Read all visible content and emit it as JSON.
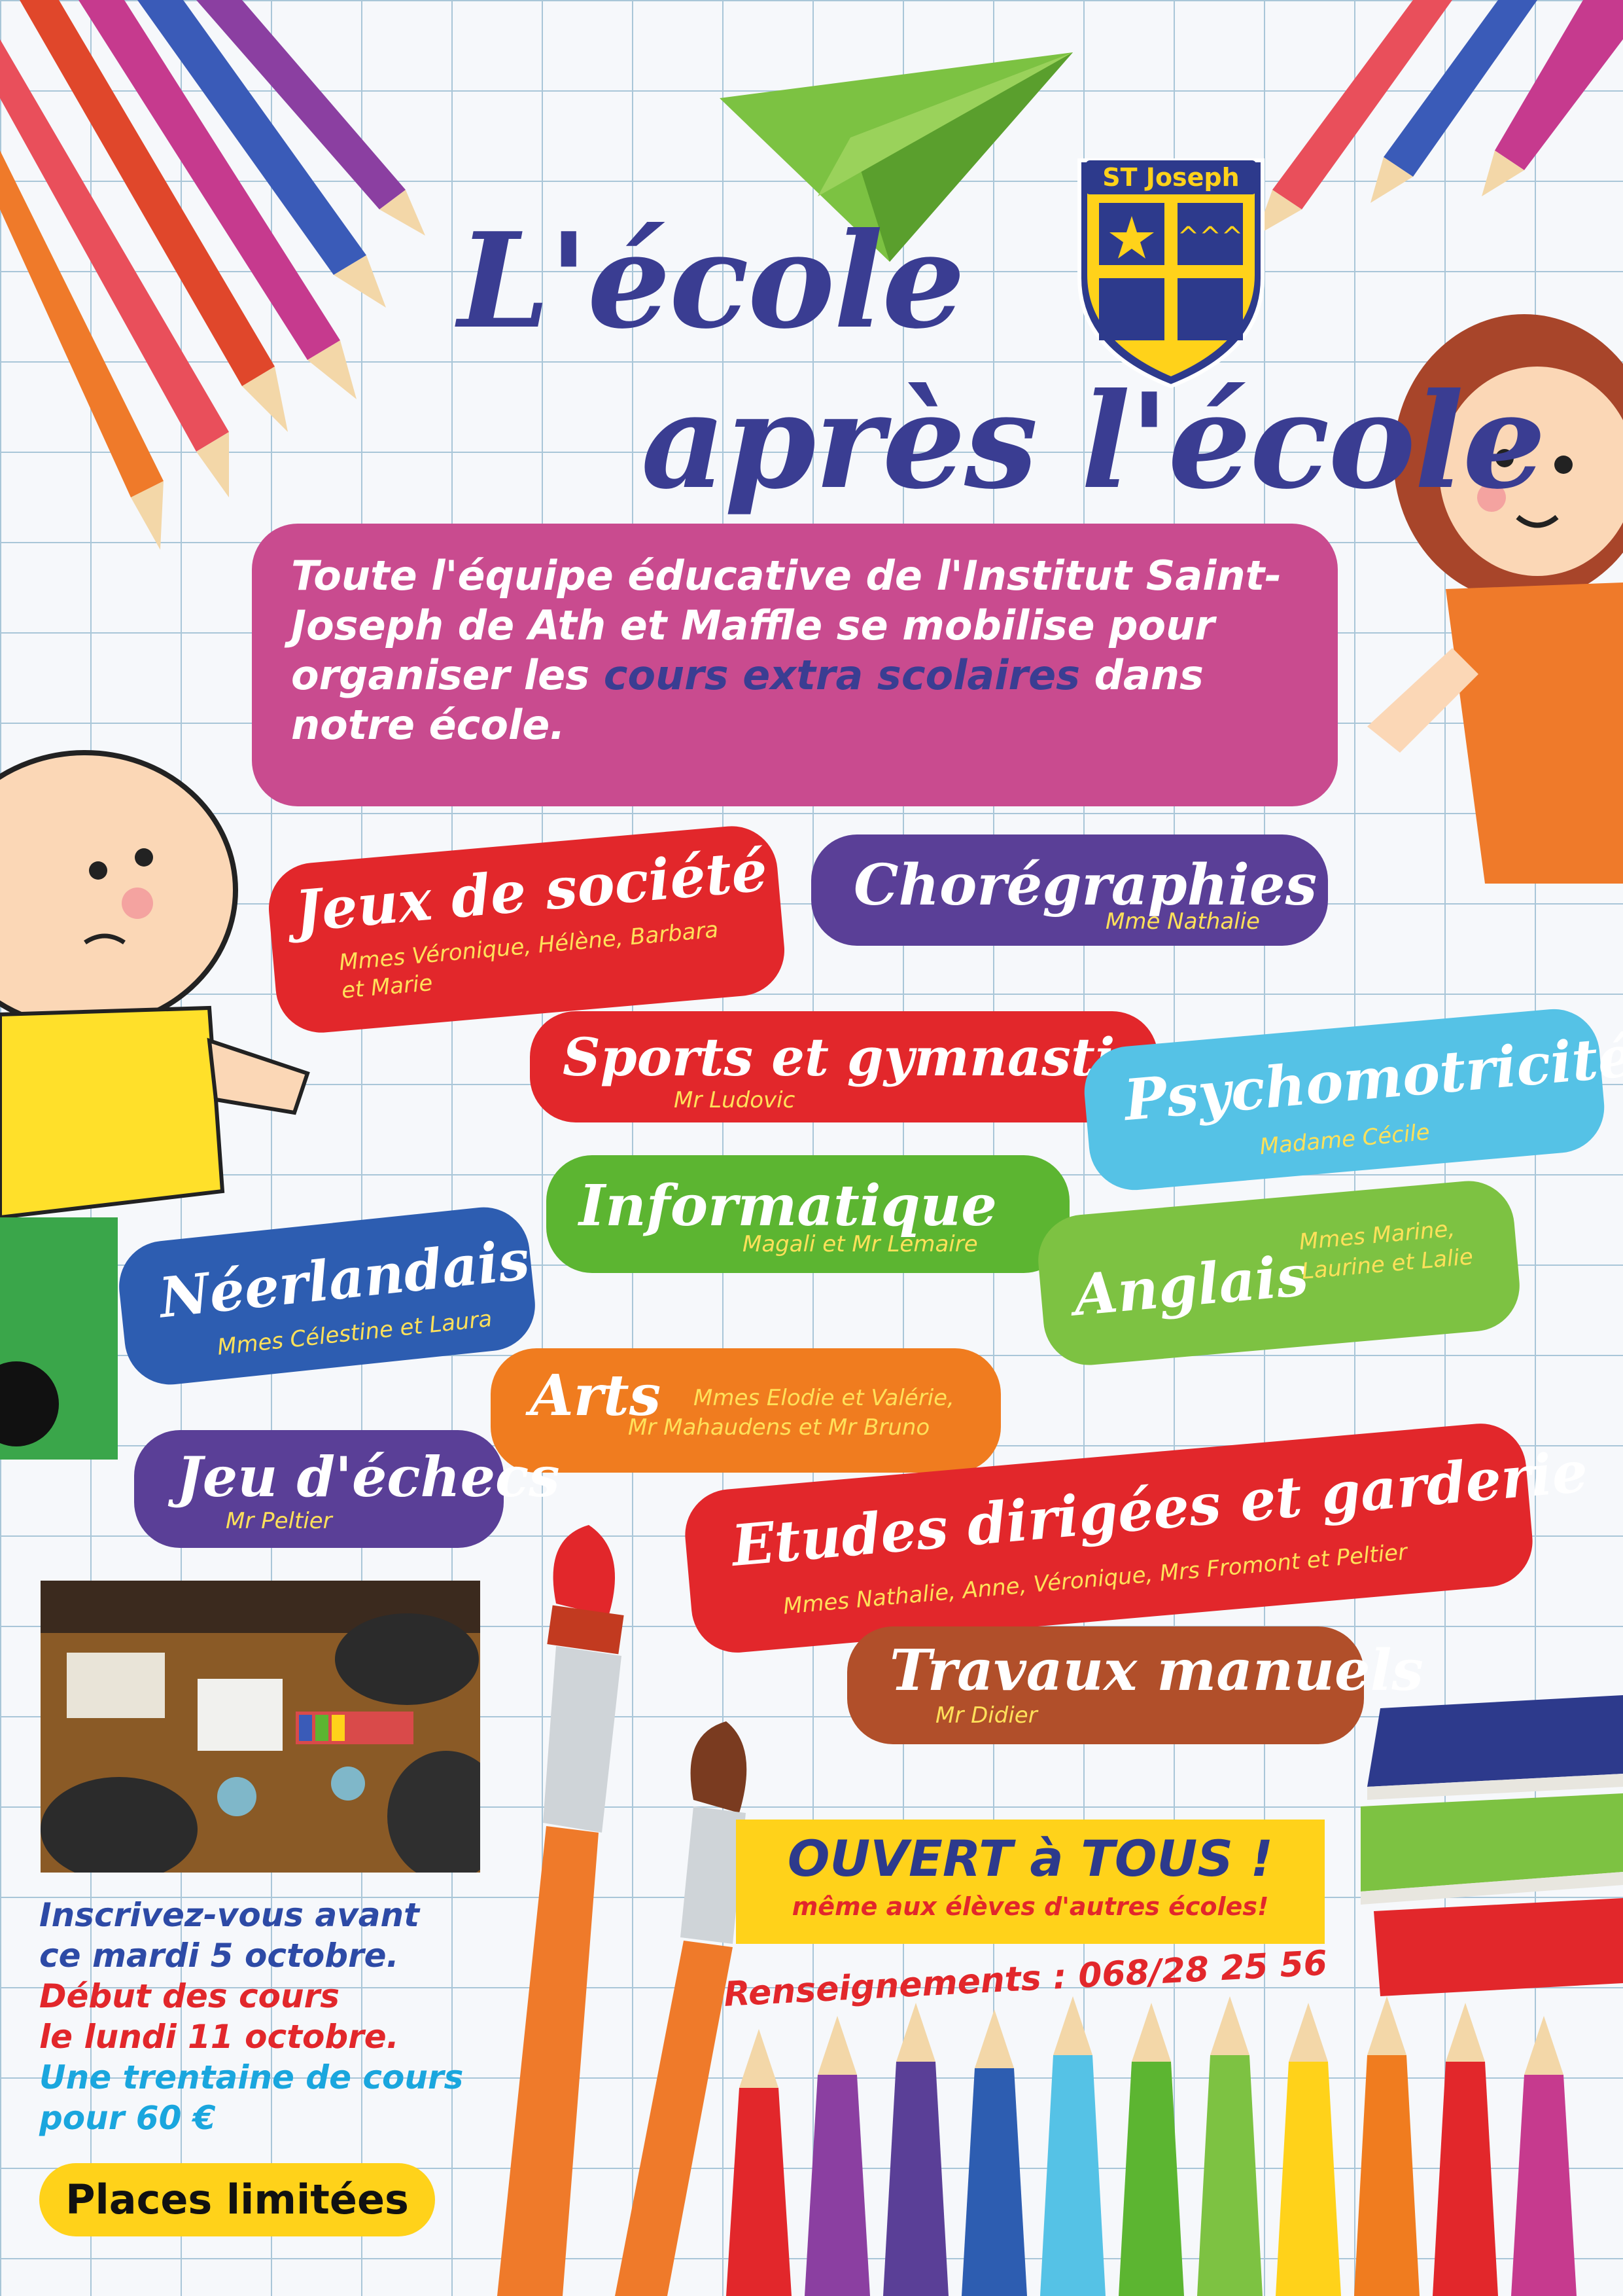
{
  "title_line1": "L'école",
  "title_line2": "après l'école",
  "logo_text": "ST Joseph",
  "intro": {
    "text_before": "Toute l'équipe éducative de l'Institut Saint-Joseph de Ath et Maffle se mobilise pour organiser les ",
    "highlight": "cours extra scolaires",
    "text_after": " dans notre école."
  },
  "activities": [
    {
      "name": "Jeux de société",
      "teachers": "Mmes Véronique, Hélène, Barbara",
      "teachers2": "et Marie",
      "color": "#e2272b"
    },
    {
      "name": "Chorégraphies",
      "teachers": "Mme Nathalie",
      "color": "#5a3f97"
    },
    {
      "name": "Sports et gymnastique",
      "teachers": "Mr Ludovic",
      "color": "#e2272b"
    },
    {
      "name": "Psychomotricité",
      "teachers": "Madame Cécile",
      "color": "#55c2e6"
    },
    {
      "name": "Informatique",
      "teachers": "Magali et Mr Lemaire",
      "color": "#5cb531"
    },
    {
      "name": "Néerlandais",
      "teachers": "Mmes Célestine et Laura",
      "color": "#2d5db1"
    },
    {
      "name": "Anglais",
      "teachers": "Mmes Marine,",
      "teachers2": "Laurine et Lalie",
      "color": "#7dc242"
    },
    {
      "name": "Arts",
      "teachers": "Mmes Elodie et Valérie,",
      "teachers2": "Mr Mahaudens et Mr Bruno",
      "color": "#f07c1f"
    },
    {
      "name": "Jeu d'échecs",
      "teachers": "Mr Peltier",
      "color": "#5a3f97"
    },
    {
      "name": "Etudes dirigées et garderie",
      "teachers": "Mmes Nathalie, Anne, Véronique, Mrs Fromont et Peltier",
      "color": "#e2272b"
    },
    {
      "name": "Travaux manuels",
      "teachers": "Mr Didier",
      "color": "#b14f2a"
    }
  ],
  "sidebar": {
    "line1": "Inscrivez-vous avant",
    "line2": "ce mardi 5 octobre.",
    "line3": "Début des cours",
    "line4": "le lundi 11 octobre.",
    "line5": "Une trentaine de cours",
    "line6": "pour 60 €",
    "places": "Places limitées"
  },
  "ouvert": {
    "big": "OUVERT à TOUS !",
    "small": "même aux élèves d'autres écoles!"
  },
  "renseignements": "Renseignements : 068/28 25 56",
  "colors": {
    "title": "#3a3d92",
    "intro_bg": "#c94b8f",
    "yellow": "#ffd21a",
    "red": "#e2272b"
  }
}
